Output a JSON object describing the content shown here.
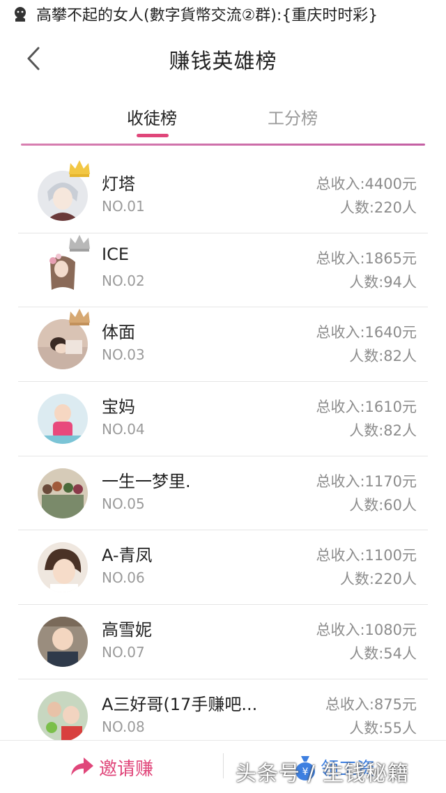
{
  "notification": {
    "text": "高攀不起的女人(數字貨幣交流②群):{重庆时时彩}",
    "icon": "chat-bubble-icon"
  },
  "header": {
    "title": "赚钱英雄榜",
    "back_icon": "chevron-left-icon"
  },
  "tabs": [
    {
      "label": "收徒榜",
      "active": true
    },
    {
      "label": "工分榜",
      "active": false
    }
  ],
  "colors": {
    "accent": "#e0467a",
    "divider_gradient_start": "#d87fb0",
    "divider_gradient_end": "#c45fa3",
    "gold_crown": "#f2c744",
    "silver_crown": "#b8b8b8",
    "bronze_crown": "#d6a872",
    "reward_blue": "#3d7fe0"
  },
  "leaderboard": [
    {
      "name": "灯塔",
      "rank": "NO.01",
      "income": "总收入:4400元",
      "people": "人数:220人",
      "crown": "gold"
    },
    {
      "name": "ICE",
      "rank": "NO.02",
      "income": "总收入:1865元",
      "people": "人数:94人",
      "crown": "silver"
    },
    {
      "name": "体面",
      "rank": "NO.03",
      "income": "总收入:1640元",
      "people": "人数:82人",
      "crown": "bronze"
    },
    {
      "name": "宝妈",
      "rank": "NO.04",
      "income": "总收入:1610元",
      "people": "人数:82人",
      "crown": "none"
    },
    {
      "name": "一生一梦里.",
      "rank": "NO.05",
      "income": "总收入:1170元",
      "people": "人数:60人",
      "crown": "none"
    },
    {
      "name": "A-青凤",
      "rank": "NO.06",
      "income": "总收入:1100元",
      "people": "人数:220人",
      "crown": "none"
    },
    {
      "name": "高雪妮",
      "rank": "NO.07",
      "income": "总收入:1080元",
      "people": "人数:54人",
      "crown": "none"
    },
    {
      "name": "A三好哥(17手赚吧...",
      "rank": "NO.08",
      "income": "总收入:875元",
      "people": "人数:55人",
      "crown": "none"
    }
  ],
  "bottom_bar": {
    "invite_label": "邀请赚",
    "invite_icon": "share-arrow-icon",
    "reward_label": "领工资",
    "reward_icon": "money-bag-icon"
  },
  "watermark": "头条号 / 生钱秘籍"
}
